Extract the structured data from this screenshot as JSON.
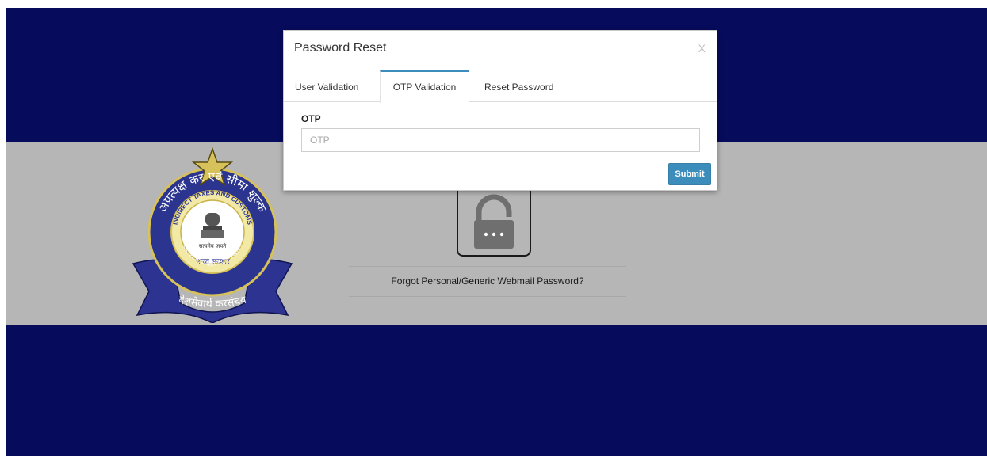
{
  "modal": {
    "title": "Password Reset",
    "close_label": "X",
    "tabs": [
      {
        "label": "User Validation"
      },
      {
        "label": "OTP Validation",
        "active": true
      },
      {
        "label": "Reset Password"
      }
    ],
    "otp": {
      "label": "OTP",
      "value": "",
      "placeholder": "OTP"
    },
    "submit_label": "Submit"
  },
  "background": {
    "forgot_link": "Forgot Personal/Generic Webmail Password?",
    "emblem": {
      "text_top_hindi": "अप्रत्यक्ष कर एवं सीमा शुल्क",
      "text_english": "INDIRECT TAXES AND CUSTOMS",
      "text_motto": "सत्यमेव जयते",
      "text_hindi_govt": "भारत सरकार",
      "text_govt": "GOVERNMENT OF INDIA",
      "ribbon_text": "देशसेवार्थ करसंचय"
    }
  },
  "colors": {
    "page_bg": "#070b5b",
    "band_bg": "#b6b6b6",
    "accent": "#3c8dbc"
  },
  "icons": {
    "emblem": "cbic-emblem-icon",
    "lock": "padlock-icon",
    "close": "close-icon"
  }
}
